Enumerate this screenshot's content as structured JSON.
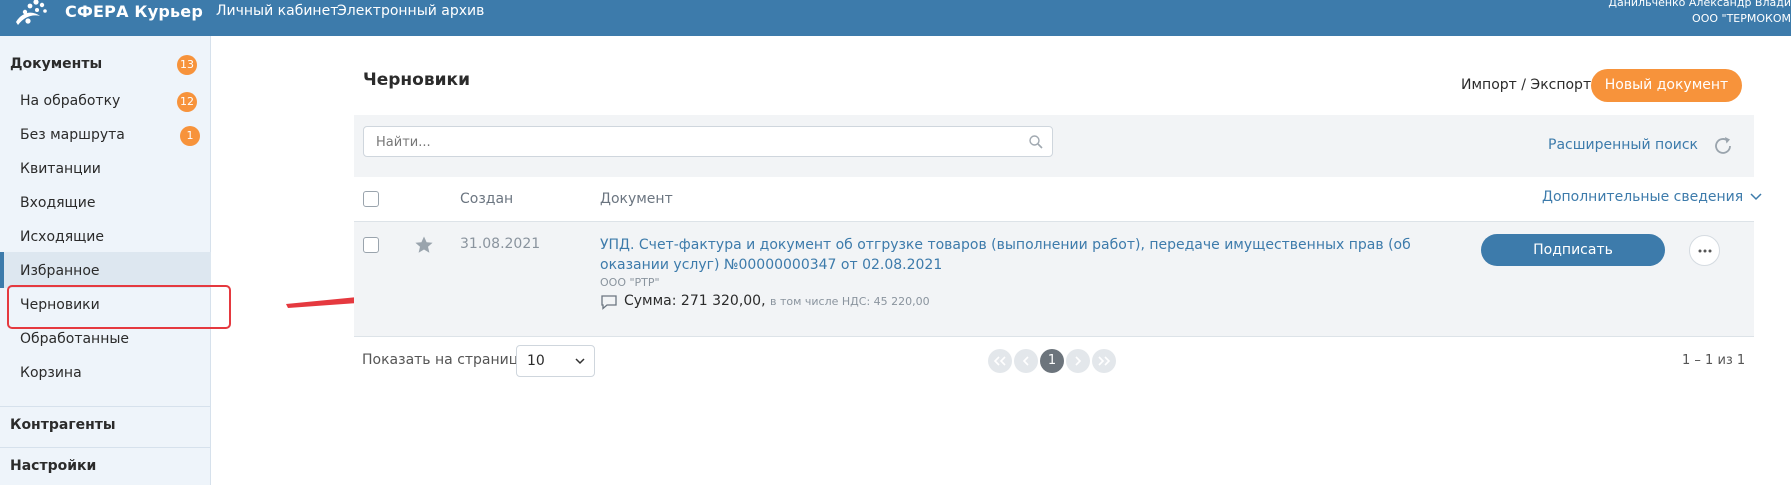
{
  "app": {
    "name": "СФЕРА Курьер",
    "nav": [
      "Личный кабинет",
      "Электронный архив"
    ],
    "user_name": "Данильченко Александр Влади",
    "user_org": "ООО \"ТЕРМОКОМ"
  },
  "sidebar": {
    "documents_label": "Документы",
    "documents_count": "13",
    "items": [
      {
        "label": "На обработку",
        "count": "12"
      },
      {
        "label": "Без маршрута",
        "count": "1"
      },
      {
        "label": "Квитанции"
      },
      {
        "label": "Входящие"
      },
      {
        "label": "Исходящие"
      },
      {
        "label": "Избранное"
      },
      {
        "label": "Черновики",
        "active": true
      },
      {
        "label": "Обработанные"
      },
      {
        "label": "Корзина"
      }
    ],
    "counterparties_label": "Контрагенты",
    "settings_label": "Настройки"
  },
  "main": {
    "title": "Черновики",
    "import_export": "Импорт / Экспорт",
    "new_document": "Новый документ",
    "search_placeholder": "Найти...",
    "advanced_search": "Расширенный поиск",
    "columns": {
      "created": "Создан",
      "document": "Документ",
      "extra": "Дополнительные сведения"
    },
    "rows": [
      {
        "date": "31.08.2021",
        "title": "УПД. Счет-фактура и документ об отгрузке товаров (выполнении работ), передаче имущественных прав (об оказании услуг) №00000000347 от 02.08.2021",
        "org": "ООО \"РТР\"",
        "sum": "Сумма: 271 320,00,",
        "vat": "в том числе НДС: 45 220,00",
        "action": "Подписать"
      }
    ],
    "per_page_label": "Показать на странице:",
    "per_page_value": "10",
    "current_page": "1",
    "range": "1 – 1 из 1"
  },
  "colors": {
    "brand": "#3d7bab",
    "accent": "#f7933b",
    "annotation": "#e5393f"
  }
}
